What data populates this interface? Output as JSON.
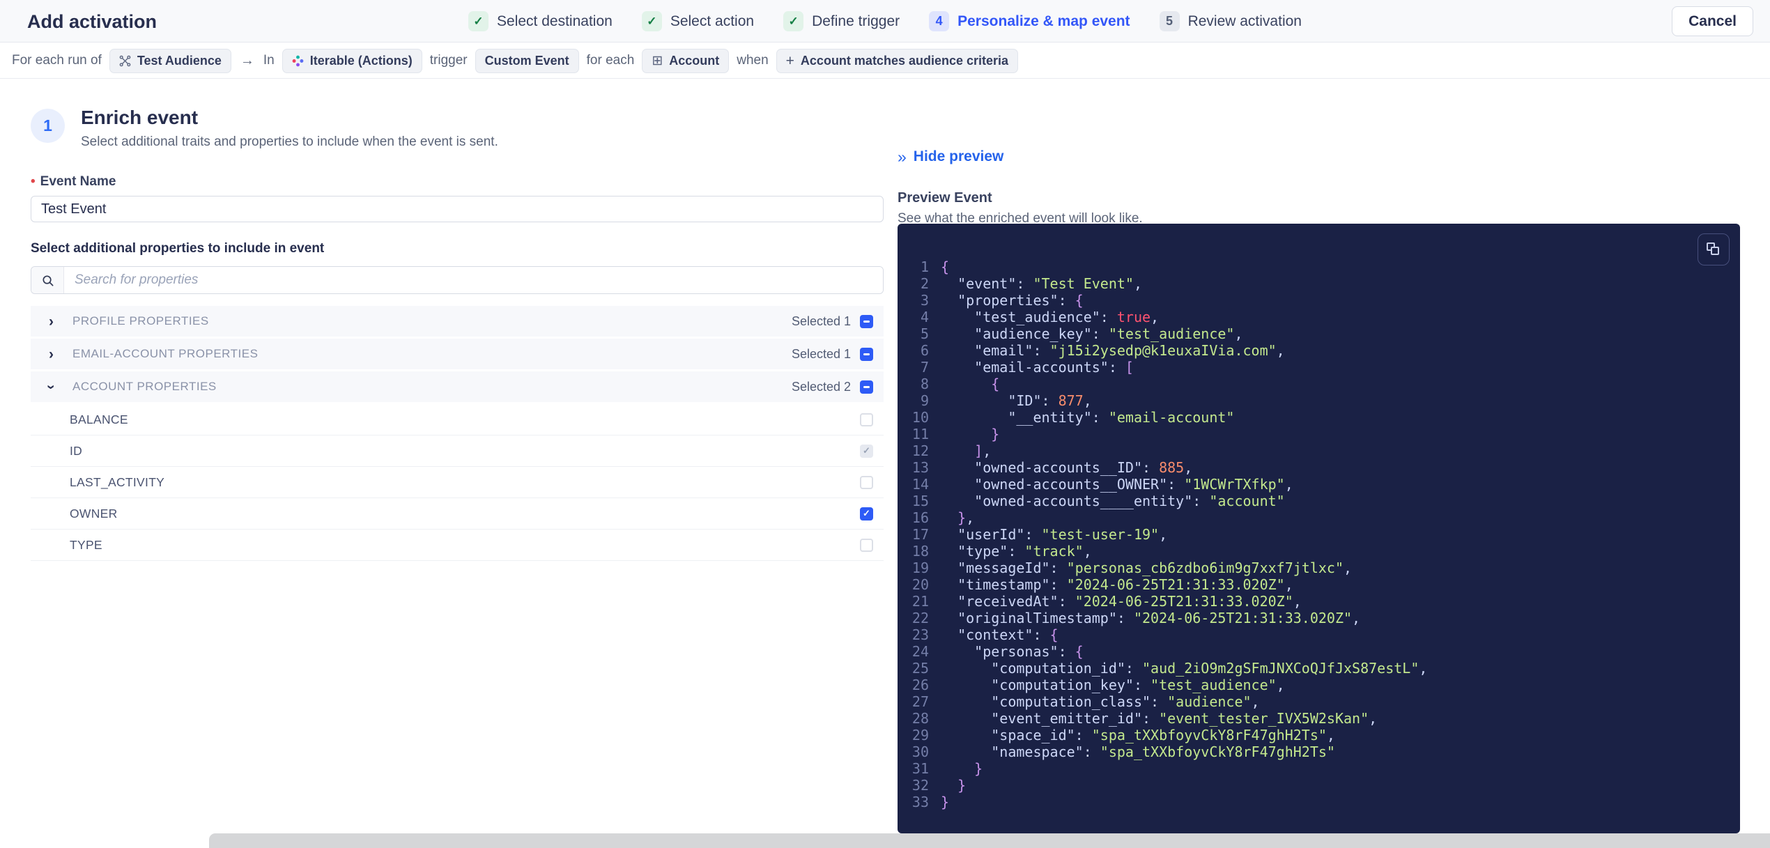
{
  "header": {
    "title": "Add activation",
    "cancel_label": "Cancel",
    "steps": [
      {
        "label": "Select destination",
        "status": "done",
        "icon": "check-icon"
      },
      {
        "label": "Select action",
        "status": "done",
        "icon": "check-icon"
      },
      {
        "label": "Define trigger",
        "status": "done",
        "icon": "check-icon"
      },
      {
        "label": "Personalize & map event",
        "status": "active",
        "number": "4"
      },
      {
        "label": "Review activation",
        "status": "upcoming",
        "number": "5"
      }
    ]
  },
  "condition_bar": {
    "tokens": [
      {
        "type": "text",
        "label": "For each run of"
      },
      {
        "type": "chip",
        "icon": "audience-icon",
        "label": "Test Audience"
      },
      {
        "type": "icon",
        "icon": "arrow-right-icon",
        "label": "→"
      },
      {
        "type": "text",
        "label": "In"
      },
      {
        "type": "chip",
        "icon": "iterable-icon",
        "label": "Iterable (Actions)"
      },
      {
        "type": "text",
        "label": "trigger"
      },
      {
        "type": "chip",
        "label": "Custom Event"
      },
      {
        "type": "text",
        "label": "for each"
      },
      {
        "type": "chip",
        "icon": "table-icon",
        "label": "Account"
      },
      {
        "type": "text",
        "label": "when"
      },
      {
        "type": "chip",
        "icon": "plus-icon",
        "label": "Account matches audience criteria"
      }
    ]
  },
  "enrich": {
    "step_number": "1",
    "title": "Enrich event",
    "subtitle": "Select additional traits and properties to include when the event is sent.",
    "event_name_label": "Event Name",
    "event_name_required_marker": "•",
    "event_name_value": "Test Event",
    "properties_label": "Select additional properties to include in event",
    "search_placeholder": "Search for properties",
    "sections": [
      {
        "label": "PROFILE PROPERTIES",
        "selected": "Selected 1",
        "expanded": false,
        "rows": []
      },
      {
        "label": "EMAIL-ACCOUNT PROPERTIES",
        "selected": "Selected 1",
        "expanded": false,
        "rows": []
      },
      {
        "label": "ACCOUNT PROPERTIES",
        "selected": "Selected 2",
        "expanded": true,
        "rows": [
          {
            "label": "BALANCE",
            "checkbox": "unchecked"
          },
          {
            "label": "ID",
            "checkbox": "checked-disabled"
          },
          {
            "label": "LAST_ACTIVITY",
            "checkbox": "unchecked"
          },
          {
            "label": "OWNER",
            "checkbox": "checked"
          },
          {
            "label": "TYPE",
            "checkbox": "unchecked"
          }
        ]
      }
    ]
  },
  "preview": {
    "hide_label": "Hide preview",
    "hide_icon": "»",
    "title": "Preview Event",
    "subtitle": "See what the enriched event will look like.",
    "code_lines": [
      {
        "num": 1,
        "seg": [
          [
            "b",
            "{"
          ]
        ]
      },
      {
        "num": 2,
        "seg": [
          [
            "k",
            "  \"event\""
          ],
          [
            "d",
            ": "
          ],
          [
            "s",
            "\"Test Event\""
          ],
          [
            "d",
            ","
          ]
        ]
      },
      {
        "num": 3,
        "seg": [
          [
            "k",
            "  \"properties\""
          ],
          [
            "d",
            ": "
          ],
          [
            "b",
            "{"
          ]
        ]
      },
      {
        "num": 4,
        "seg": [
          [
            "k",
            "    \"test_audience\""
          ],
          [
            "d",
            ": "
          ],
          [
            "t",
            "true"
          ],
          [
            "d",
            ","
          ]
        ]
      },
      {
        "num": 5,
        "seg": [
          [
            "k",
            "    \"audience_key\""
          ],
          [
            "d",
            ": "
          ],
          [
            "s",
            "\"test_audience\""
          ],
          [
            "d",
            ","
          ]
        ]
      },
      {
        "num": 6,
        "seg": [
          [
            "k",
            "    \"email\""
          ],
          [
            "d",
            ": "
          ],
          [
            "s",
            "\"j15i2ysedp@k1euxaIVia.com\""
          ],
          [
            "d",
            ","
          ]
        ]
      },
      {
        "num": 7,
        "seg": [
          [
            "k",
            "    \"email-accounts\""
          ],
          [
            "d",
            ": "
          ],
          [
            "b",
            "["
          ]
        ]
      },
      {
        "num": 8,
        "seg": [
          [
            "b",
            "      {"
          ]
        ]
      },
      {
        "num": 9,
        "seg": [
          [
            "k",
            "        \"ID\""
          ],
          [
            "d",
            ": "
          ],
          [
            "n",
            "877"
          ],
          [
            "d",
            ","
          ]
        ]
      },
      {
        "num": 10,
        "seg": [
          [
            "k",
            "        \"__entity\""
          ],
          [
            "d",
            ": "
          ],
          [
            "s",
            "\"email-account\""
          ]
        ]
      },
      {
        "num": 11,
        "seg": [
          [
            "b",
            "      }"
          ]
        ]
      },
      {
        "num": 12,
        "seg": [
          [
            "b",
            "    ]"
          ],
          [
            "d",
            ","
          ]
        ]
      },
      {
        "num": 13,
        "seg": [
          [
            "k",
            "    \"owned-accounts__ID\""
          ],
          [
            "d",
            ": "
          ],
          [
            "n",
            "885"
          ],
          [
            "d",
            ","
          ]
        ]
      },
      {
        "num": 14,
        "seg": [
          [
            "k",
            "    \"owned-accounts__OWNER\""
          ],
          [
            "d",
            ": "
          ],
          [
            "s",
            "\"1WCWrTXfkp\""
          ],
          [
            "d",
            ","
          ]
        ]
      },
      {
        "num": 15,
        "seg": [
          [
            "k",
            "    \"owned-accounts____entity\""
          ],
          [
            "d",
            ": "
          ],
          [
            "s",
            "\"account\""
          ]
        ]
      },
      {
        "num": 16,
        "seg": [
          [
            "b",
            "  }"
          ],
          [
            "d",
            ","
          ]
        ]
      },
      {
        "num": 17,
        "seg": [
          [
            "k",
            "  \"userId\""
          ],
          [
            "d",
            ": "
          ],
          [
            "s",
            "\"test-user-19\""
          ],
          [
            "d",
            ","
          ]
        ]
      },
      {
        "num": 18,
        "seg": [
          [
            "k",
            "  \"type\""
          ],
          [
            "d",
            ": "
          ],
          [
            "s",
            "\"track\""
          ],
          [
            "d",
            ","
          ]
        ]
      },
      {
        "num": 19,
        "seg": [
          [
            "k",
            "  \"messageId\""
          ],
          [
            "d",
            ": "
          ],
          [
            "s",
            "\"personas_cb6zdbo6im9g7xxf7jtlxc\""
          ],
          [
            "d",
            ","
          ]
        ]
      },
      {
        "num": 20,
        "seg": [
          [
            "k",
            "  \"timestamp\""
          ],
          [
            "d",
            ": "
          ],
          [
            "s",
            "\"2024-06-25T21:31:33.020Z\""
          ],
          [
            "d",
            ","
          ]
        ]
      },
      {
        "num": 21,
        "seg": [
          [
            "k",
            "  \"receivedAt\""
          ],
          [
            "d",
            ": "
          ],
          [
            "s",
            "\"2024-06-25T21:31:33.020Z\""
          ],
          [
            "d",
            ","
          ]
        ]
      },
      {
        "num": 22,
        "seg": [
          [
            "k",
            "  \"originalTimestamp\""
          ],
          [
            "d",
            ": "
          ],
          [
            "s",
            "\"2024-06-25T21:31:33.020Z\""
          ],
          [
            "d",
            ","
          ]
        ]
      },
      {
        "num": 23,
        "seg": [
          [
            "k",
            "  \"context\""
          ],
          [
            "d",
            ": "
          ],
          [
            "b",
            "{"
          ]
        ]
      },
      {
        "num": 24,
        "seg": [
          [
            "k",
            "    \"personas\""
          ],
          [
            "d",
            ": "
          ],
          [
            "b",
            "{"
          ]
        ]
      },
      {
        "num": 25,
        "seg": [
          [
            "k",
            "      \"computation_id\""
          ],
          [
            "d",
            ": "
          ],
          [
            "s",
            "\"aud_2iO9m2gSFmJNXCoQJfJxS87estL\""
          ],
          [
            "d",
            ","
          ]
        ]
      },
      {
        "num": 26,
        "seg": [
          [
            "k",
            "      \"computation_key\""
          ],
          [
            "d",
            ": "
          ],
          [
            "s",
            "\"test_audience\""
          ],
          [
            "d",
            ","
          ]
        ]
      },
      {
        "num": 27,
        "seg": [
          [
            "k",
            "      \"computation_class\""
          ],
          [
            "d",
            ": "
          ],
          [
            "s",
            "\"audience\""
          ],
          [
            "d",
            ","
          ]
        ]
      },
      {
        "num": 28,
        "seg": [
          [
            "k",
            "      \"event_emitter_id\""
          ],
          [
            "d",
            ": "
          ],
          [
            "s",
            "\"event_tester_IVX5W2sKan\""
          ],
          [
            "d",
            ","
          ]
        ]
      },
      {
        "num": 29,
        "seg": [
          [
            "k",
            "      \"space_id\""
          ],
          [
            "d",
            ": "
          ],
          [
            "s",
            "\"spa_tXXbfoyvCkY8rF47ghH2Ts\""
          ],
          [
            "d",
            ","
          ]
        ]
      },
      {
        "num": 30,
        "seg": [
          [
            "k",
            "      \"namespace\""
          ],
          [
            "d",
            ": "
          ],
          [
            "s",
            "\"spa_tXXbfoyvCkY8rF47ghH2Ts\""
          ]
        ]
      },
      {
        "num": 31,
        "seg": [
          [
            "b",
            "    }"
          ]
        ]
      },
      {
        "num": 32,
        "seg": [
          [
            "b",
            "  }"
          ]
        ]
      },
      {
        "num": 33,
        "seg": [
          [
            "b",
            "}"
          ]
        ]
      }
    ]
  },
  "colors": {
    "accent_blue": "#2e5bf6",
    "link_blue": "#2563eb",
    "active_step_blue": "#3357f8",
    "done_green": "#157f45",
    "required_red": "#e0474b",
    "code_background": "#1a2145",
    "code_key": "#ccd6f6",
    "code_string": "#c3e88d",
    "code_number": "#f78c6c",
    "code_boolean": "#ff5370",
    "code_brace": "#c792ea",
    "code_line_number": "#747ea8"
  }
}
